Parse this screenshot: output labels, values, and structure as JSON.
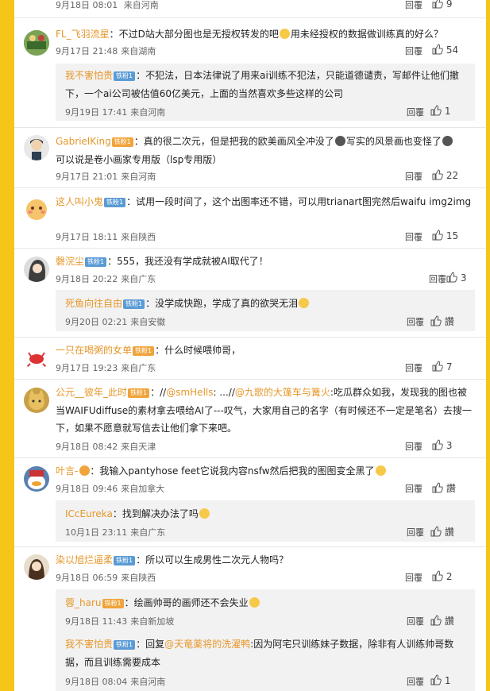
{
  "labels": {
    "reply": "回覆",
    "like_word": "讚"
  },
  "comments": [
    {
      "id": "c0",
      "name": "",
      "text": "",
      "date": "9月18日 08:01",
      "loc": "来自河南",
      "likes": "9"
    },
    {
      "id": "c1",
      "name": "FL_飞羽流星",
      "text": "不过D站大部分图也是无授权转发的吧",
      "text2": "用未经授权的数据做训练真的好么？",
      "date": "9月17日 21:48",
      "loc": "来自湖南",
      "likes": "54",
      "reply": {
        "name": "我不害怕贵",
        "badge": "铁粉1",
        "text": "不犯法，日本法律说了用来ai训练不犯法，只能道德谴责，写邮件让他们撤下，一个ai公司被估值60亿美元，上面的当然喜欢多些这样的公司",
        "date": "9月19日 17:41",
        "loc": "来自河南",
        "likes": "1"
      }
    },
    {
      "id": "c2",
      "name": "GabrielKing",
      "badge": "铁粉1",
      "text": "真的很二次元，但是把我的欧美画风全冲没了",
      "text_b": "写实的风景画也变怪了",
      "text2": "可以说是卷小画家专用版（lsp专用版）",
      "date": "9月17日 21:01",
      "loc": "来自河南",
      "likes": "22"
    },
    {
      "id": "c3",
      "name": "这人叫小鬼",
      "badge": "铁粉1",
      "text": "试用一段时间了，这个出图率还不错，可以用trianart图完然后waifu img2img",
      "date": "9月17日 18:11",
      "loc": "来自陕西",
      "likes": "15"
    },
    {
      "id": "c4",
      "name": "磬浣尘",
      "badge": "铁粉1",
      "text": "555，我还没有学成就被AI取代了！",
      "date": "9月18日 20:22",
      "loc": "来自广东",
      "likes": "3",
      "reply": {
        "name": "死鱼向往自由",
        "badge": "铁粉1",
        "text": "没学成快跑，学成了真的欲哭无泪",
        "date": "9月20日 02:21",
        "loc": "来自安徽",
        "likes": "讚"
      }
    },
    {
      "id": "c5",
      "name": "一只在喝粥的女单",
      "badge": "铁粉1",
      "text": "什么时候喂帅哥，",
      "date": "9月17日 19:23",
      "loc": "来自广东",
      "likes": "7"
    },
    {
      "id": "c6",
      "name": "公元__彼年_此时",
      "badge": "铁粉1",
      "pre": "//",
      "m1": "@smHells",
      "mid": ": ...//",
      "m2": "@九歌的大篷车与篝火",
      "text": ":吃瓜群众如我，发现我的图也被当WAIFUdiffuse的素材拿去喂给AI了---叹气，大家用自己的名字（有时候还不一定是笔名）去搜一下，如果不愿意就写信去让他们拿下来吧。",
      "date": "9月18日 08:42",
      "loc": "来自天津",
      "likes": "3"
    },
    {
      "id": "c7",
      "name": "叶言-",
      "text": "我输入pantyhose feet它说我内容nsfw然后把我的图图变全黑了",
      "date": "9月18日 09:46",
      "loc": "来自加拿大",
      "likes": "讚",
      "reply": {
        "name": "ICcEureka",
        "text": "找到解决办法了吗",
        "date": "10月1日 23:11",
        "loc": "来自广东",
        "likes": "讚"
      }
    },
    {
      "id": "c8",
      "name": "染以旭烂逼柔",
      "badge": "铁粉1",
      "text": "所以可以生成男性二次元人物吗？",
      "date": "9月18日 06:59",
      "loc": "来自陕西",
      "likes": "2",
      "replies": [
        {
          "name": "蓉_haru",
          "badge": "铁粉1",
          "text": "绘画帅哥的画师还不会失业",
          "date": "9月18日 11:43",
          "loc": "来自新加坡",
          "likes": "讚"
        },
        {
          "name": "我不害怕贵",
          "badge": "铁粉1",
          "pre": "回复",
          "m1": "@天竜薬将的洗濯鸭",
          "text": ":因为阿宅只训练妹子数据，除非有人训练帅哥数据，而且训练需要成本",
          "date": "9月18日 08:04",
          "loc": "来自河南",
          "likes": "1"
        }
      ]
    }
  ]
}
